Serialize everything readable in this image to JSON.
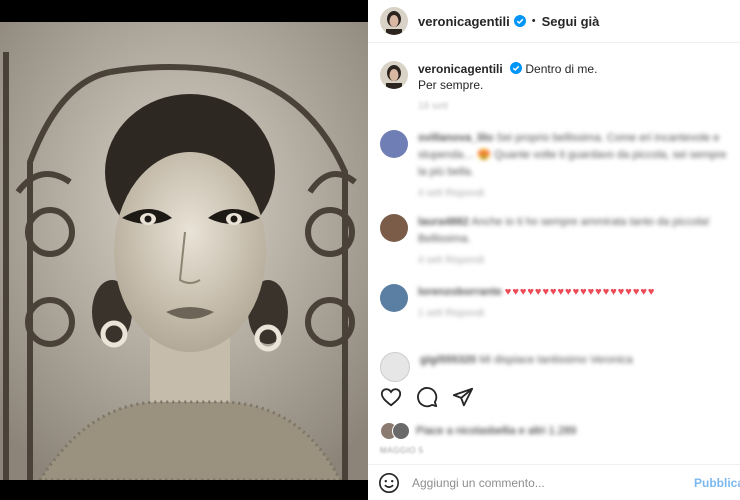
{
  "post": {
    "username": "veronicagentili",
    "follow_label": "Segui già",
    "separator": "•",
    "caption_line1": "Dentro di me.",
    "caption_line2": "Per sempre.",
    "time": "18 sett"
  },
  "comments": [
    {
      "user": "svillanova_lilo",
      "text": "Sei proprio bellissima. Come eri incantevole e stupenda… 😍 Quante volte ti guardavo da piccola, sei sempre la più bella.",
      "meta": "4 sett   Rispondi"
    },
    {
      "user": "laura4882",
      "text": "Anche io ti ho sempre ammirata tanto da piccola! Bellissima.",
      "meta": "4 sett   Rispondi"
    },
    {
      "user": "lorenzoborrante",
      "hearts": "♥♥♥♥♥♥♥♥♥♥♥♥♥♥♥♥♥♥♥♥",
      "meta": "1 sett   Rispondi"
    },
    {
      "user": "gigi555320",
      "text": "Mi dispiace tantissimo Veronica",
      "meta": ""
    }
  ],
  "likes": {
    "text": "Piace a nicolasbellia e altri 1.289"
  },
  "date": "MAGGIO 5",
  "composer": {
    "placeholder": "Aggiungi un commento...",
    "publish_label": "Pubblica"
  },
  "icons": [
    "verified-icon",
    "heart-icon",
    "comment-icon",
    "share-icon",
    "emoji-icon"
  ],
  "colors": {
    "verified": "#0095f6",
    "publish": "#0095f6",
    "heart": "#ed4956"
  }
}
